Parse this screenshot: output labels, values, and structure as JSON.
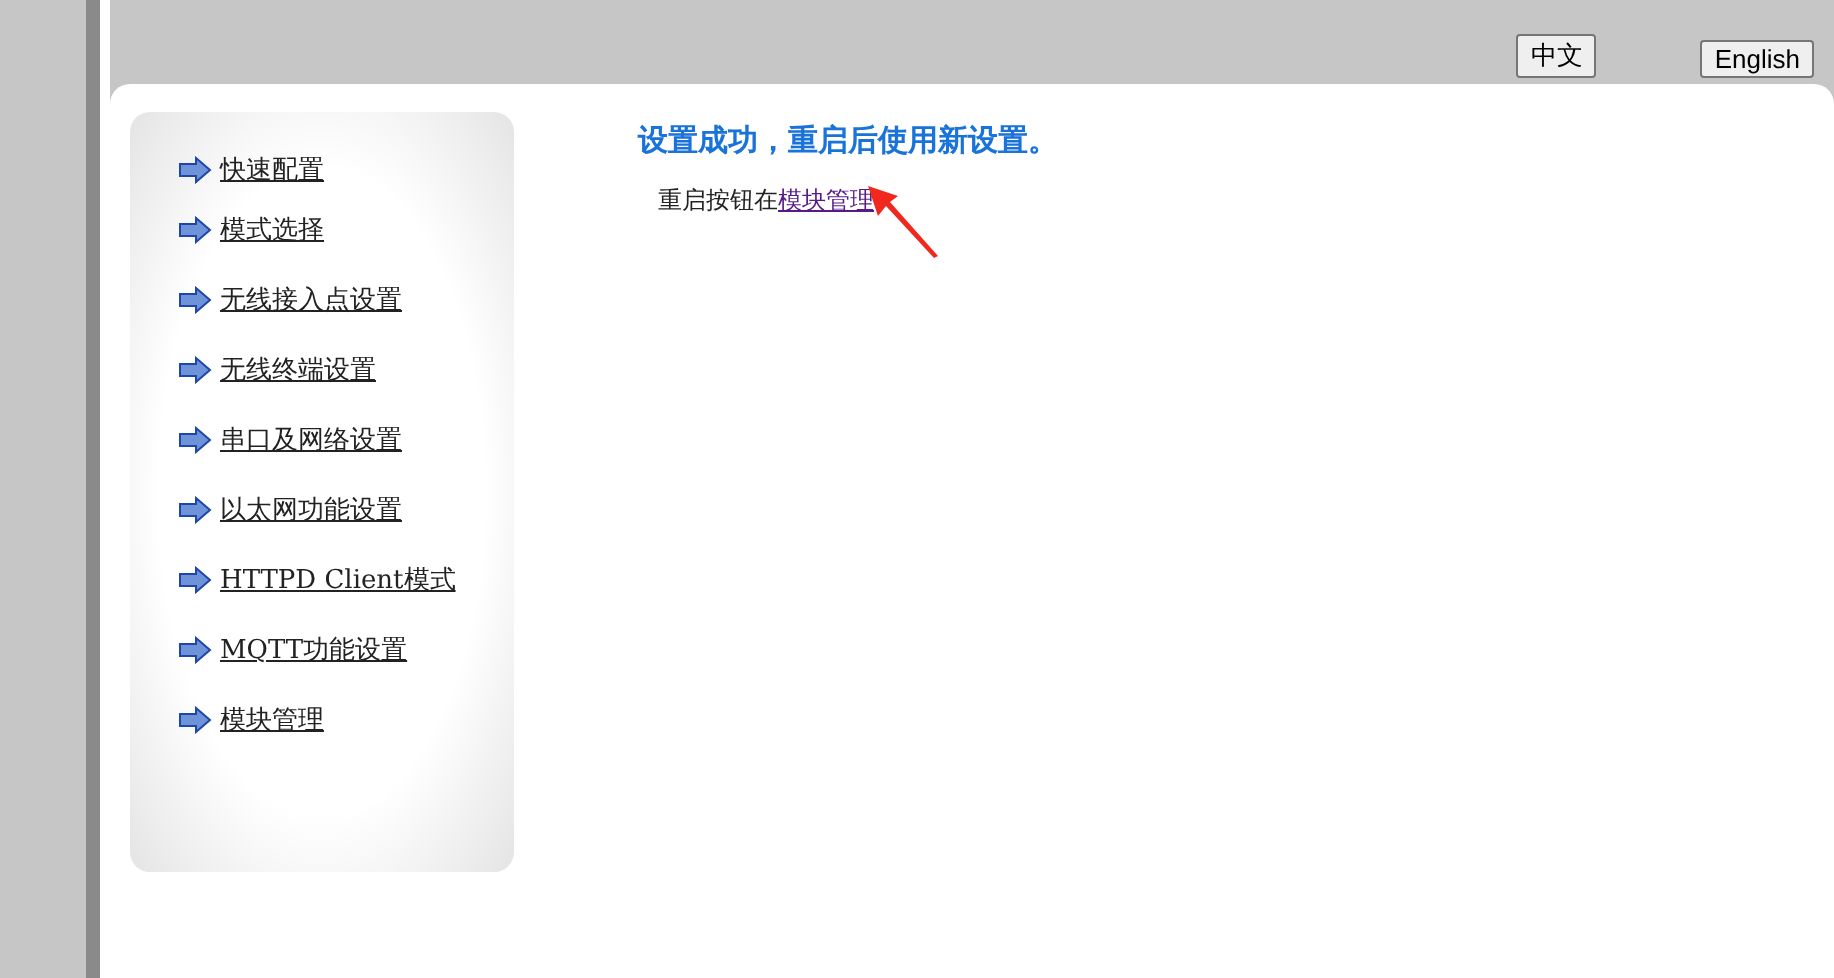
{
  "language_buttons": [
    {
      "label": "中文"
    },
    {
      "label": "English"
    }
  ],
  "sidebar": {
    "items": [
      {
        "label": "快速配置"
      },
      {
        "label": "模式选择"
      },
      {
        "label": "无线接入点设置"
      },
      {
        "label": "无线终端设置"
      },
      {
        "label": "串口及网络设置"
      },
      {
        "label": "以太网功能设置"
      },
      {
        "label": "HTTPD Client模式"
      },
      {
        "label": "MQTT功能设置"
      },
      {
        "label": "模块管理"
      }
    ]
  },
  "content": {
    "title": "设置成功，重启后使用新设置。",
    "note": "重启按钮在",
    "link": "模块管理"
  }
}
